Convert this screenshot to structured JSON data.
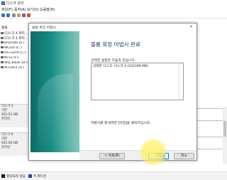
{
  "window": {
    "title": "디스크 관리"
  },
  "menu": [
    "파일(F)",
    "동작(A)",
    "보기(V)",
    "도움말(H)"
  ],
  "volumes": {
    "header": "볼륨",
    "items": [
      "(디스크 4 파티...",
      "(디스크 4 파티...",
      "Bracuda (E:)",
      "BK320 (C:)",
      "OS-Gsmt (C:)",
      "NTFS (F:)",
      "WD_Black (H:)",
      "W-Gen3 (A:)"
    ]
  },
  "disks": [
    {
      "name": "디스크 3",
      "type": "기본",
      "size": "931.51 GB",
      "status": "온라인"
    },
    {
      "name": "디스크 4",
      "type": "기본",
      "size": "931.50 GB",
      "status": "온라인"
    }
  ],
  "statusbar": {
    "unallocated": "할당되지 않음",
    "primary": "주 파티션"
  },
  "dialog": {
    "title": "볼륨 확장 마법사",
    "close": "×",
    "heading": "볼륨 확장 마법사 완료",
    "subtitle": "선택한 설정은 다음과 같습니다.",
    "selection": "선택한 디스크: 디스크 4 (102399 MB)",
    "close_instruction": "마법사를 끝내려면 [마침]을 클릭하십시오.",
    "buttons": {
      "back": "< 뒤로(B)",
      "finish": "마침",
      "cancel": "취소"
    }
  },
  "colors": {
    "accent": "#0078d7",
    "banner": "#1a8f85",
    "heading": "#1f3f6e",
    "highlight": "#fff06e"
  }
}
